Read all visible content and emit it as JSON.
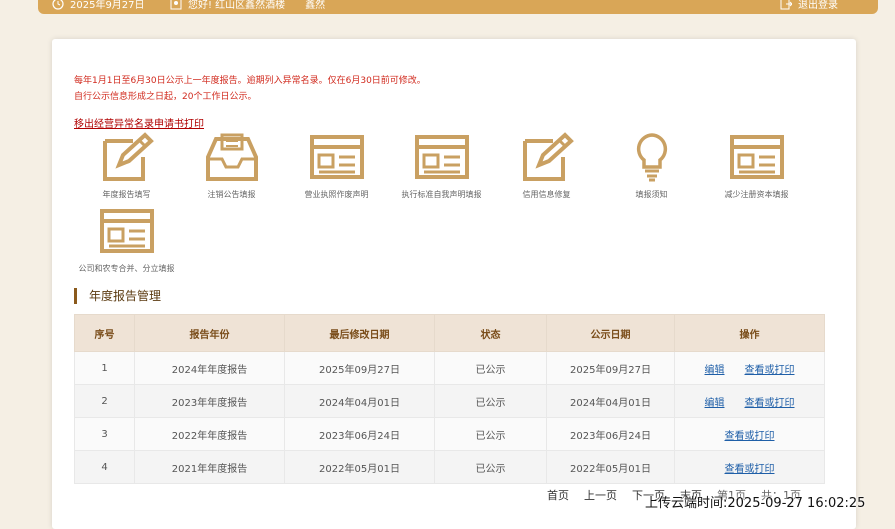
{
  "topbar": {
    "date": "2025年9月27日",
    "greeting": "您好! 红山区鑫然酒楼",
    "user_suffix": "鑫然",
    "logout": "退出登录"
  },
  "notice": {
    "line1": "每年1月1日至6月30日公示上一年度报告。逾期列入异常名录。仅在6月30日前可修改。",
    "line2": "自行公示信息形成之日起，20个工作日公示。"
  },
  "removal_link": "移出经营异常名录申请书打印",
  "tiles": [
    {
      "label": "年度报告填写",
      "icon": "edit-icon"
    },
    {
      "label": "注销公告填报",
      "icon": "inbox-icon"
    },
    {
      "label": "营业执照作废声明",
      "icon": "card-icon"
    },
    {
      "label": "执行标准自我声明填报",
      "icon": "card-icon"
    },
    {
      "label": "信用信息修复",
      "icon": "edit-icon"
    },
    {
      "label": "填报须知",
      "icon": "lightbulb-icon"
    },
    {
      "label": "减少注册资本填报",
      "icon": "card-icon"
    },
    {
      "label": "公司和农专合并、分立填报",
      "icon": "card-icon"
    }
  ],
  "section_title": "年度报告管理",
  "table": {
    "headers": [
      "序号",
      "报告年份",
      "最后修改日期",
      "状态",
      "公示日期",
      "操作"
    ],
    "rows": [
      {
        "no": "1",
        "year": "2024年年度报告",
        "modified": "2025年09月27日",
        "status": "已公示",
        "publish": "2025年09月27日",
        "edit": "编辑",
        "view": "查看或打印"
      },
      {
        "no": "2",
        "year": "2023年年度报告",
        "modified": "2024年04月01日",
        "status": "已公示",
        "publish": "2024年04月01日",
        "edit": "编辑",
        "view": "查看或打印"
      },
      {
        "no": "3",
        "year": "2022年年度报告",
        "modified": "2023年06月24日",
        "status": "已公示",
        "publish": "2023年06月24日",
        "edit": "",
        "view": "查看或打印"
      },
      {
        "no": "4",
        "year": "2021年年度报告",
        "modified": "2022年05月01日",
        "status": "已公示",
        "publish": "2022年05月01日",
        "edit": "",
        "view": "查看或打印"
      }
    ]
  },
  "pager": {
    "first": "首页",
    "prev": "上一页",
    "next": "下一页",
    "last": "末页",
    "page_info": "第1页",
    "total_info": "共：1页"
  },
  "watermark": "上传云端时间:2025-09-27 16:02:25",
  "colors": {
    "accent": "#d9a657",
    "icon": "#c9a062",
    "notice": "#d12a1e"
  }
}
